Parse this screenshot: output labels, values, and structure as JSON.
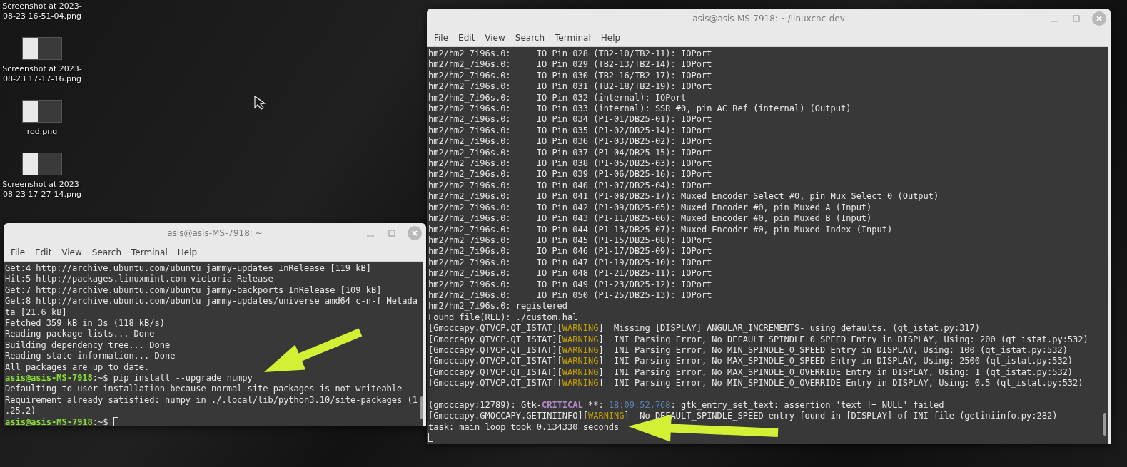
{
  "desktop": {
    "icons": [
      {
        "label": "Screenshot at 2023-\n08-23 16-51-04.png",
        "kind": "cut"
      },
      {
        "label": "Screenshot at 2023-\n08-23 17-17-16.png",
        "kind": "image"
      },
      {
        "label": "rod.png",
        "kind": "image"
      },
      {
        "label": "Screenshot at 2023-\n08-23 17-27-14.png",
        "kind": "image"
      }
    ]
  },
  "windows": [
    {
      "title": "asis@asis-MS-7918: ~/linuxcnc-dev",
      "menu": [
        "File",
        "Edit",
        "View",
        "Search",
        "Terminal",
        "Help"
      ],
      "lines": [
        "hm2/hm2_7i96s.0:     IO Pin 028 (TB2-10/TB2-11): IOPort",
        "hm2/hm2_7i96s.0:     IO Pin 029 (TB2-13/TB2-14): IOPort",
        "hm2/hm2_7i96s.0:     IO Pin 030 (TB2-16/TB2-17): IOPort",
        "hm2/hm2_7i96s.0:     IO Pin 031 (TB2-18/TB2-19): IOPort",
        "hm2/hm2_7i96s.0:     IO Pin 032 (internal): IOPort",
        "hm2/hm2_7i96s.0:     IO Pin 033 (internal): SSR #0, pin AC Ref (internal) (Output)",
        "hm2/hm2_7i96s.0:     IO Pin 034 (P1-01/DB25-01): IOPort",
        "hm2/hm2_7i96s.0:     IO Pin 035 (P1-02/DB25-14): IOPort",
        "hm2/hm2_7i96s.0:     IO Pin 036 (P1-03/DB25-02): IOPort",
        "hm2/hm2_7i96s.0:     IO Pin 037 (P1-04/DB25-15): IOPort",
        "hm2/hm2_7i96s.0:     IO Pin 038 (P1-05/DB25-03): IOPort",
        "hm2/hm2_7i96s.0:     IO Pin 039 (P1-06/DB25-16): IOPort",
        "hm2/hm2_7i96s.0:     IO Pin 040 (P1-07/DB25-04): IOPort",
        "hm2/hm2_7i96s.0:     IO Pin 041 (P1-08/DB25-17): Muxed Encoder Select #0, pin Mux Select 0 (Output)",
        "hm2/hm2_7i96s.0:     IO Pin 042 (P1-09/DB25-05): Muxed Encoder #0, pin Muxed A (Input)",
        "hm2/hm2_7i96s.0:     IO Pin 043 (P1-11/DB25-06): Muxed Encoder #0, pin Muxed B (Input)",
        "hm2/hm2_7i96s.0:     IO Pin 044 (P1-13/DB25-07): Muxed Encoder #0, pin Muxed Index (Input)",
        "hm2/hm2_7i96s.0:     IO Pin 045 (P1-15/DB25-08): IOPort",
        "hm2/hm2_7i96s.0:     IO Pin 046 (P1-17/DB25-09): IOPort",
        "hm2/hm2_7i96s.0:     IO Pin 047 (P1-19/DB25-10): IOPort",
        "hm2/hm2_7i96s.0:     IO Pin 048 (P1-21/DB25-11): IOPort",
        "hm2/hm2_7i96s.0:     IO Pin 049 (P1-23/DB25-12): IOPort",
        "hm2/hm2_7i96s.0:     IO Pin 050 (P1-25/DB25-13): IOPort",
        "hm2/hm2_7i96s.0: registered",
        "Found file(REL): ./custom.hal",
        {
          "segments": [
            {
              "text": "[Gmoccapy.QTVCP.QT_ISTAT][",
              "kind": "plain"
            },
            {
              "text": "WARNING",
              "kind": "warning"
            },
            {
              "text": "]  Missing [DISPLAY] ANGULAR_INCREMENTS- using defaults. (qt_istat.py:317)",
              "kind": "plain"
            }
          ]
        },
        {
          "segments": [
            {
              "text": "[Gmoccapy.QTVCP.QT_ISTAT][",
              "kind": "plain"
            },
            {
              "text": "WARNING",
              "kind": "warning"
            },
            {
              "text": "]  INI Parsing Error, No DEFAULT_SPINDLE_0_SPEED Entry in DISPLAY, Using: 200 (qt_istat.py:532)",
              "kind": "plain"
            }
          ]
        },
        {
          "segments": [
            {
              "text": "[Gmoccapy.QTVCP.QT_ISTAT][",
              "kind": "plain"
            },
            {
              "text": "WARNING",
              "kind": "warning"
            },
            {
              "text": "]  INI Parsing Error, No MIN_SPINDLE_0_SPEED Entry in DISPLAY, Using: 100 (qt_istat.py:532)",
              "kind": "plain"
            }
          ]
        },
        {
          "segments": [
            {
              "text": "[Gmoccapy.QTVCP.QT_ISTAT][",
              "kind": "plain"
            },
            {
              "text": "WARNING",
              "kind": "warning"
            },
            {
              "text": "]  INI Parsing Error, No MAX_SPINDLE_0_SPEED Entry in DISPLAY, Using: 2500 (qt_istat.py:532)",
              "kind": "plain"
            }
          ]
        },
        {
          "segments": [
            {
              "text": "[Gmoccapy.QTVCP.QT_ISTAT][",
              "kind": "plain"
            },
            {
              "text": "WARNING",
              "kind": "warning"
            },
            {
              "text": "]  INI Parsing Error, No MAX_SPINDLE_0_OVERRIDE Entry in DISPLAY, Using: 1 (qt_istat.py:532)",
              "kind": "plain"
            }
          ]
        },
        {
          "segments": [
            {
              "text": "[Gmoccapy.QTVCP.QT_ISTAT][",
              "kind": "plain"
            },
            {
              "text": "WARNING",
              "kind": "warning"
            },
            {
              "text": "]  INI Parsing Error, No MIN_SPINDLE_0_OVERRIDE Entry in DISPLAY, Using: 0.5 (qt_istat.py:532)",
              "kind": "plain"
            }
          ]
        },
        {
          "gap_before": true,
          "segments": [
            {
              "text": "(gmoccapy:12789): Gtk-",
              "kind": "plain"
            },
            {
              "text": "CRITICAL",
              "kind": "critical"
            },
            {
              "text": " **: ",
              "kind": "plain"
            },
            {
              "text": "18:09:52.768",
              "kind": "timestamp"
            },
            {
              "text": ": gtk_entry_set_text: assertion 'text != NULL' failed",
              "kind": "plain"
            }
          ]
        },
        {
          "segments": [
            {
              "text": "[Gmoccapy.GMOCCAPY.GETINIINFO][",
              "kind": "plain"
            },
            {
              "text": "WARNING",
              "kind": "warning"
            },
            {
              "text": "]  No DEFAULT_SPINDLE_SPEED entry found in [DISPLAY] of INI file (getiniinfo.py:282)",
              "kind": "plain"
            }
          ]
        },
        "task: main loop took 0.134330 seconds",
        {
          "cursor": true
        }
      ]
    },
    {
      "title": "asis@asis-MS-7918: ~",
      "menu": [
        "File",
        "Edit",
        "View",
        "Search",
        "Terminal",
        "Help"
      ],
      "lines": [
        "Get:4 http://archive.ubuntu.com/ubuntu jammy-updates InRelease [119 kB]",
        "Hit:5 http://packages.linuxmint.com victoria Release",
        "Get:7 http://archive.ubuntu.com/ubuntu jammy-backports InRelease [109 kB]",
        "Get:8 http://archive.ubuntu.com/ubuntu jammy-updates/universe amd64 c-n-f Metada",
        "ta [21.6 kB]",
        "Fetched 359 kB in 3s (118 kB/s)",
        "Reading package lists... Done",
        "Building dependency tree... Done",
        "Reading state information... Done",
        "All packages are up to date.",
        {
          "segments": [
            {
              "text": "asis@asis-MS-7918",
              "kind": "prompt"
            },
            {
              "text": ":~$ pip install --upgrade numpy",
              "kind": "plain"
            }
          ]
        },
        "Defaulting to user installation because normal site-packages is not writeable",
        "Requirement already satisfied: numpy in ./.local/lib/python3.10/site-packages (1",
        ".25.2)",
        {
          "cursor": true,
          "segments": [
            {
              "text": "asis@asis-MS-7918",
              "kind": "prompt"
            },
            {
              "text": ":~$ ",
              "kind": "plain"
            }
          ]
        }
      ]
    }
  ]
}
